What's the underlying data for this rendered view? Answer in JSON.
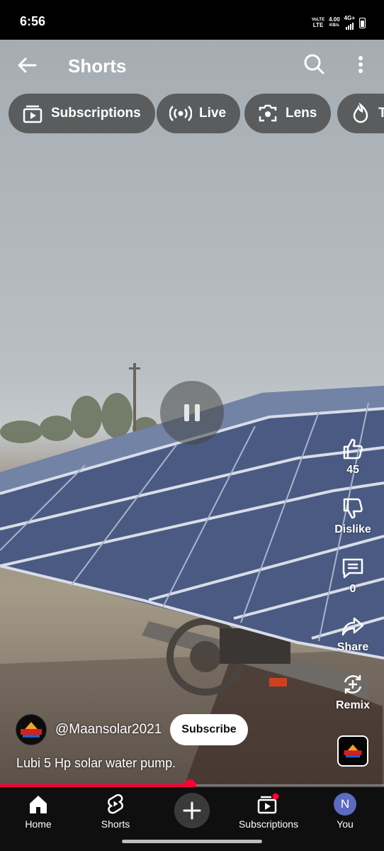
{
  "status_bar": {
    "time": "6:56",
    "network_top": "VoLTE",
    "network_bottom": "LTE",
    "speed_value": "4.00",
    "speed_unit": "KB/s",
    "signal_type": "4G+",
    "icons": [
      "signal-icon",
      "battery-icon"
    ]
  },
  "header": {
    "title": "Shorts",
    "icons": [
      "back-arrow-icon",
      "search-icon",
      "more-vert-icon"
    ]
  },
  "chips": [
    {
      "label": "Subscriptions",
      "icon": "subscriptions-icon"
    },
    {
      "label": "Live",
      "icon": "live-icon"
    },
    {
      "label": "Lens",
      "icon": "lens-icon"
    },
    {
      "label": "T",
      "icon": "trending-icon"
    }
  ],
  "player": {
    "state_icon": "pause-icon",
    "progress_fraction": 0.495
  },
  "actions": {
    "like_count": "45",
    "dislike_label": "Dislike",
    "comment_count": "0",
    "share_label": "Share",
    "remix_label": "Remix"
  },
  "channel": {
    "handle": "@Maansolar2021",
    "subscribe_label": "Subscribe",
    "caption": "Lubi 5 Hp solar water pump."
  },
  "nav": {
    "home": "Home",
    "shorts": "Shorts",
    "subscriptions": "Subscriptions",
    "you": "You",
    "you_initial": "N"
  },
  "colors": {
    "accent_red": "#ff0033",
    "nav_background": "#0f0f0f",
    "avatar_purple": "#5c6bc0"
  }
}
